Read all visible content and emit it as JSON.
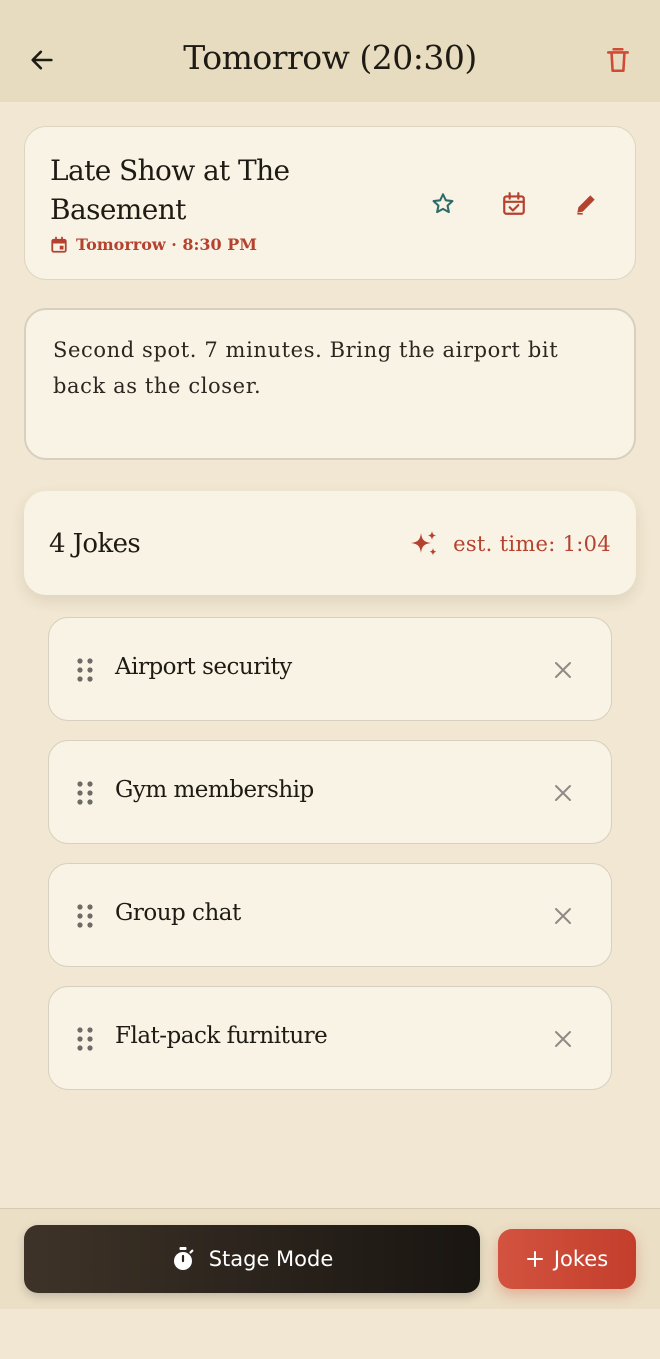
{
  "header": {
    "title": "Tomorrow (20:30)"
  },
  "show": {
    "title": "Late Show at The Basement",
    "date_text": "Tomorrow · 8:30 PM"
  },
  "notes": {
    "text": "Second spot. 7 minutes. Bring the airport bit back as the closer."
  },
  "setlist": {
    "count_label": "4 Jokes",
    "est_time_label": "est. time: 1:04",
    "jokes": [
      {
        "label": "Airport security"
      },
      {
        "label": "Gym membership"
      },
      {
        "label": "Group chat"
      },
      {
        "label": "Flat-pack furniture"
      }
    ]
  },
  "actions": {
    "stage_mode_label": "Stage Mode",
    "add_jokes_label": "Jokes"
  },
  "colors": {
    "accent": "#b5412f",
    "teal": "#2f6b6a",
    "background": "#f1e7d2",
    "card": "#f8f3e4"
  },
  "icons": {
    "back": "arrow-left-icon",
    "delete": "trash-icon",
    "favorite": "star-outline-icon",
    "schedule": "calendar-check-icon",
    "edit": "pencil-icon",
    "date": "calendar-icon",
    "sparkle": "sparkles-icon",
    "drag": "drag-handle-icon",
    "remove": "close-icon",
    "stopwatch": "stopwatch-icon",
    "plus": "plus-icon"
  }
}
